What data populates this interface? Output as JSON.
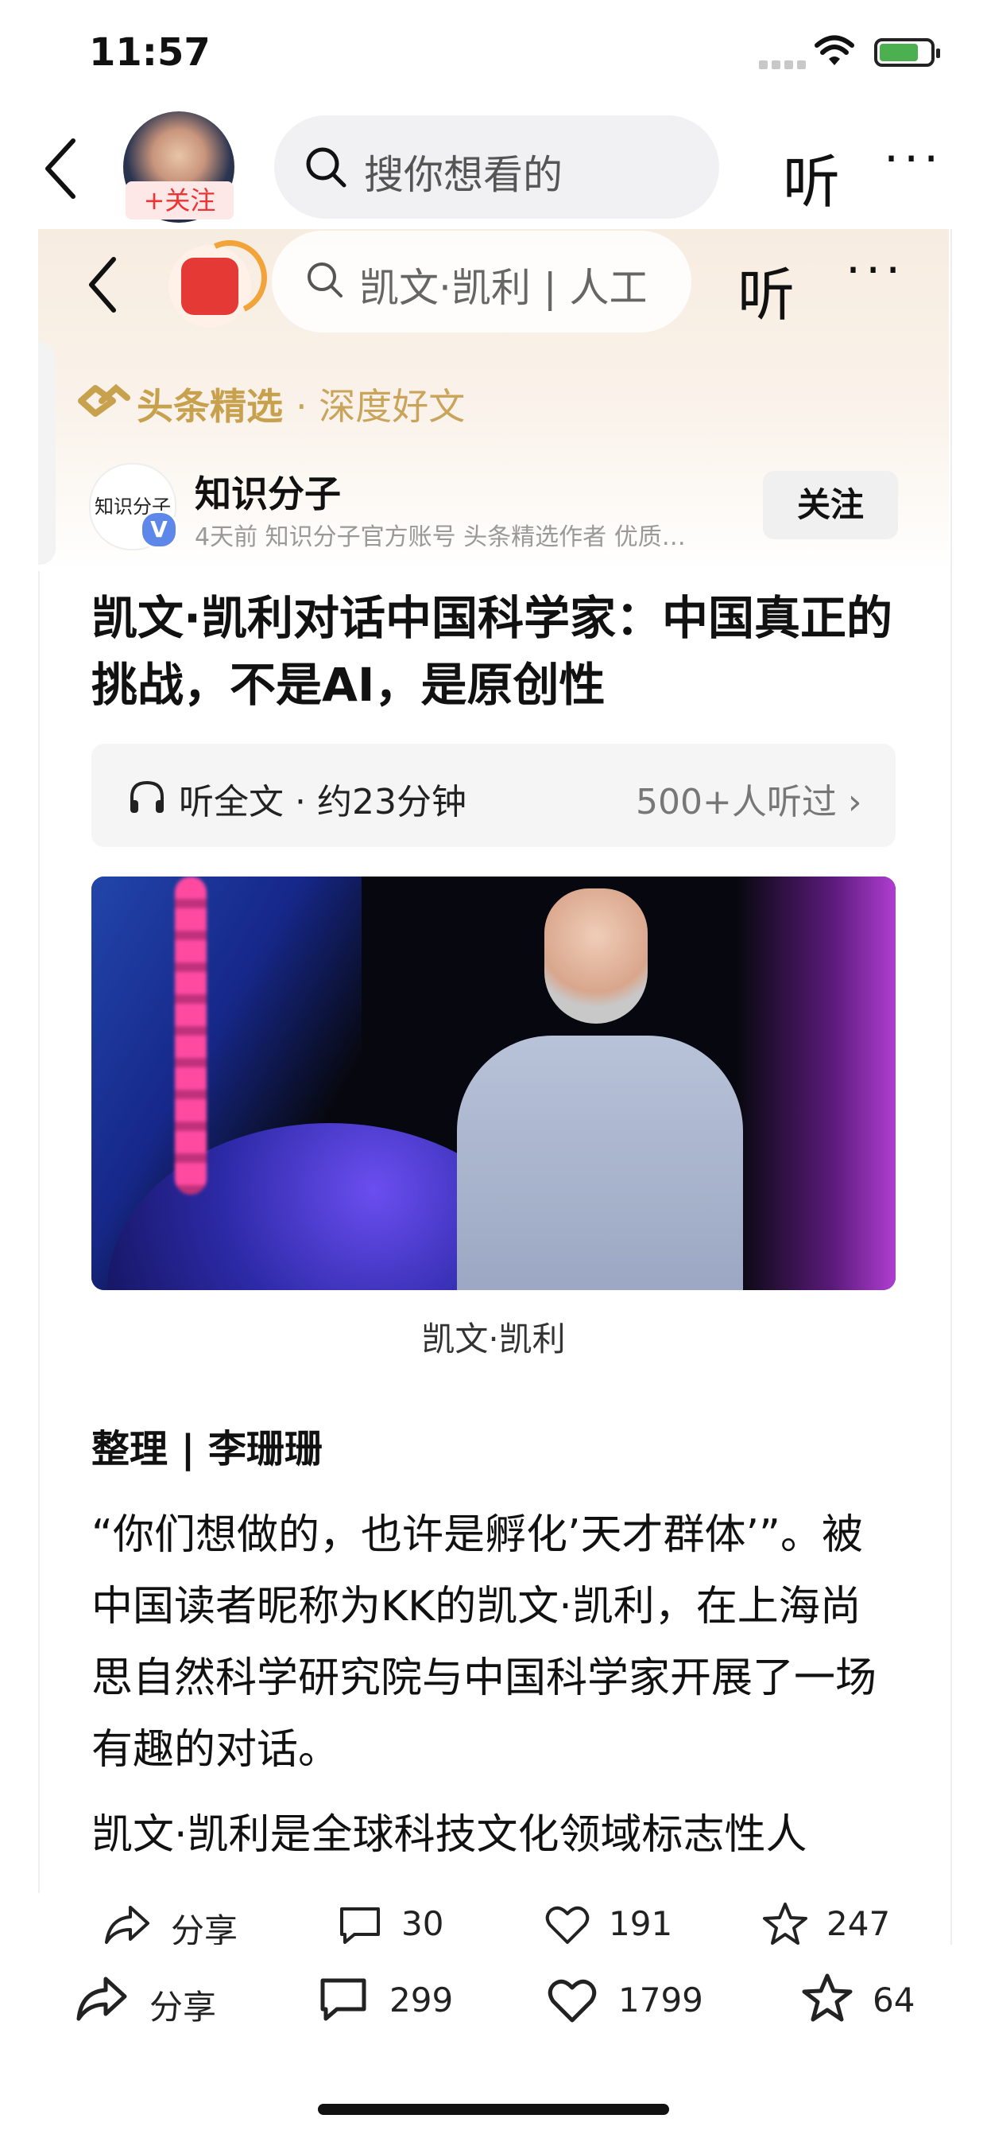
{
  "status": {
    "time": "11:57"
  },
  "top_nav": {
    "follow_tag": "+关注",
    "search_placeholder": "搜你想看的",
    "listen_label": "听",
    "more_label": "···"
  },
  "inner_nav": {
    "search_text": "凯文·凯利 | 人工",
    "listen_label": "听",
    "more_label": "···"
  },
  "brand": {
    "name": "头条精选",
    "sub": "· 深度好文"
  },
  "publisher": {
    "name": "知识分子",
    "avatar_text": "知识分子",
    "verified": "V",
    "meta": "4天前  知识分子官方账号 头条精选作者 优质…",
    "follow_label": "关注"
  },
  "article": {
    "title": "凯文·凯利对话中国科学家：中国真正的挑战，不是AI，是原创性",
    "listen_text": "听全文 · 约23分钟",
    "listen_count": "500+人听过 ›",
    "image_caption": "凯文·凯利",
    "author_line": "整理 | 李珊珊",
    "paragraph1": "“你们想做的，也许是孵化’天才群体’”。被中国读者昵称为KK的凯文·凯利，在上海尚思自然科学研究院与中国科学家开展了一场有趣的对话。",
    "paragraph2": "凯文·凯利是全球科技文化领域标志性人"
  },
  "inner_actions": {
    "share": "分享",
    "comments": "30",
    "likes": "191",
    "favorites": "247"
  },
  "bottom_actions": {
    "share": "分享",
    "comments": "299",
    "likes": "1799",
    "favorites": "64"
  }
}
